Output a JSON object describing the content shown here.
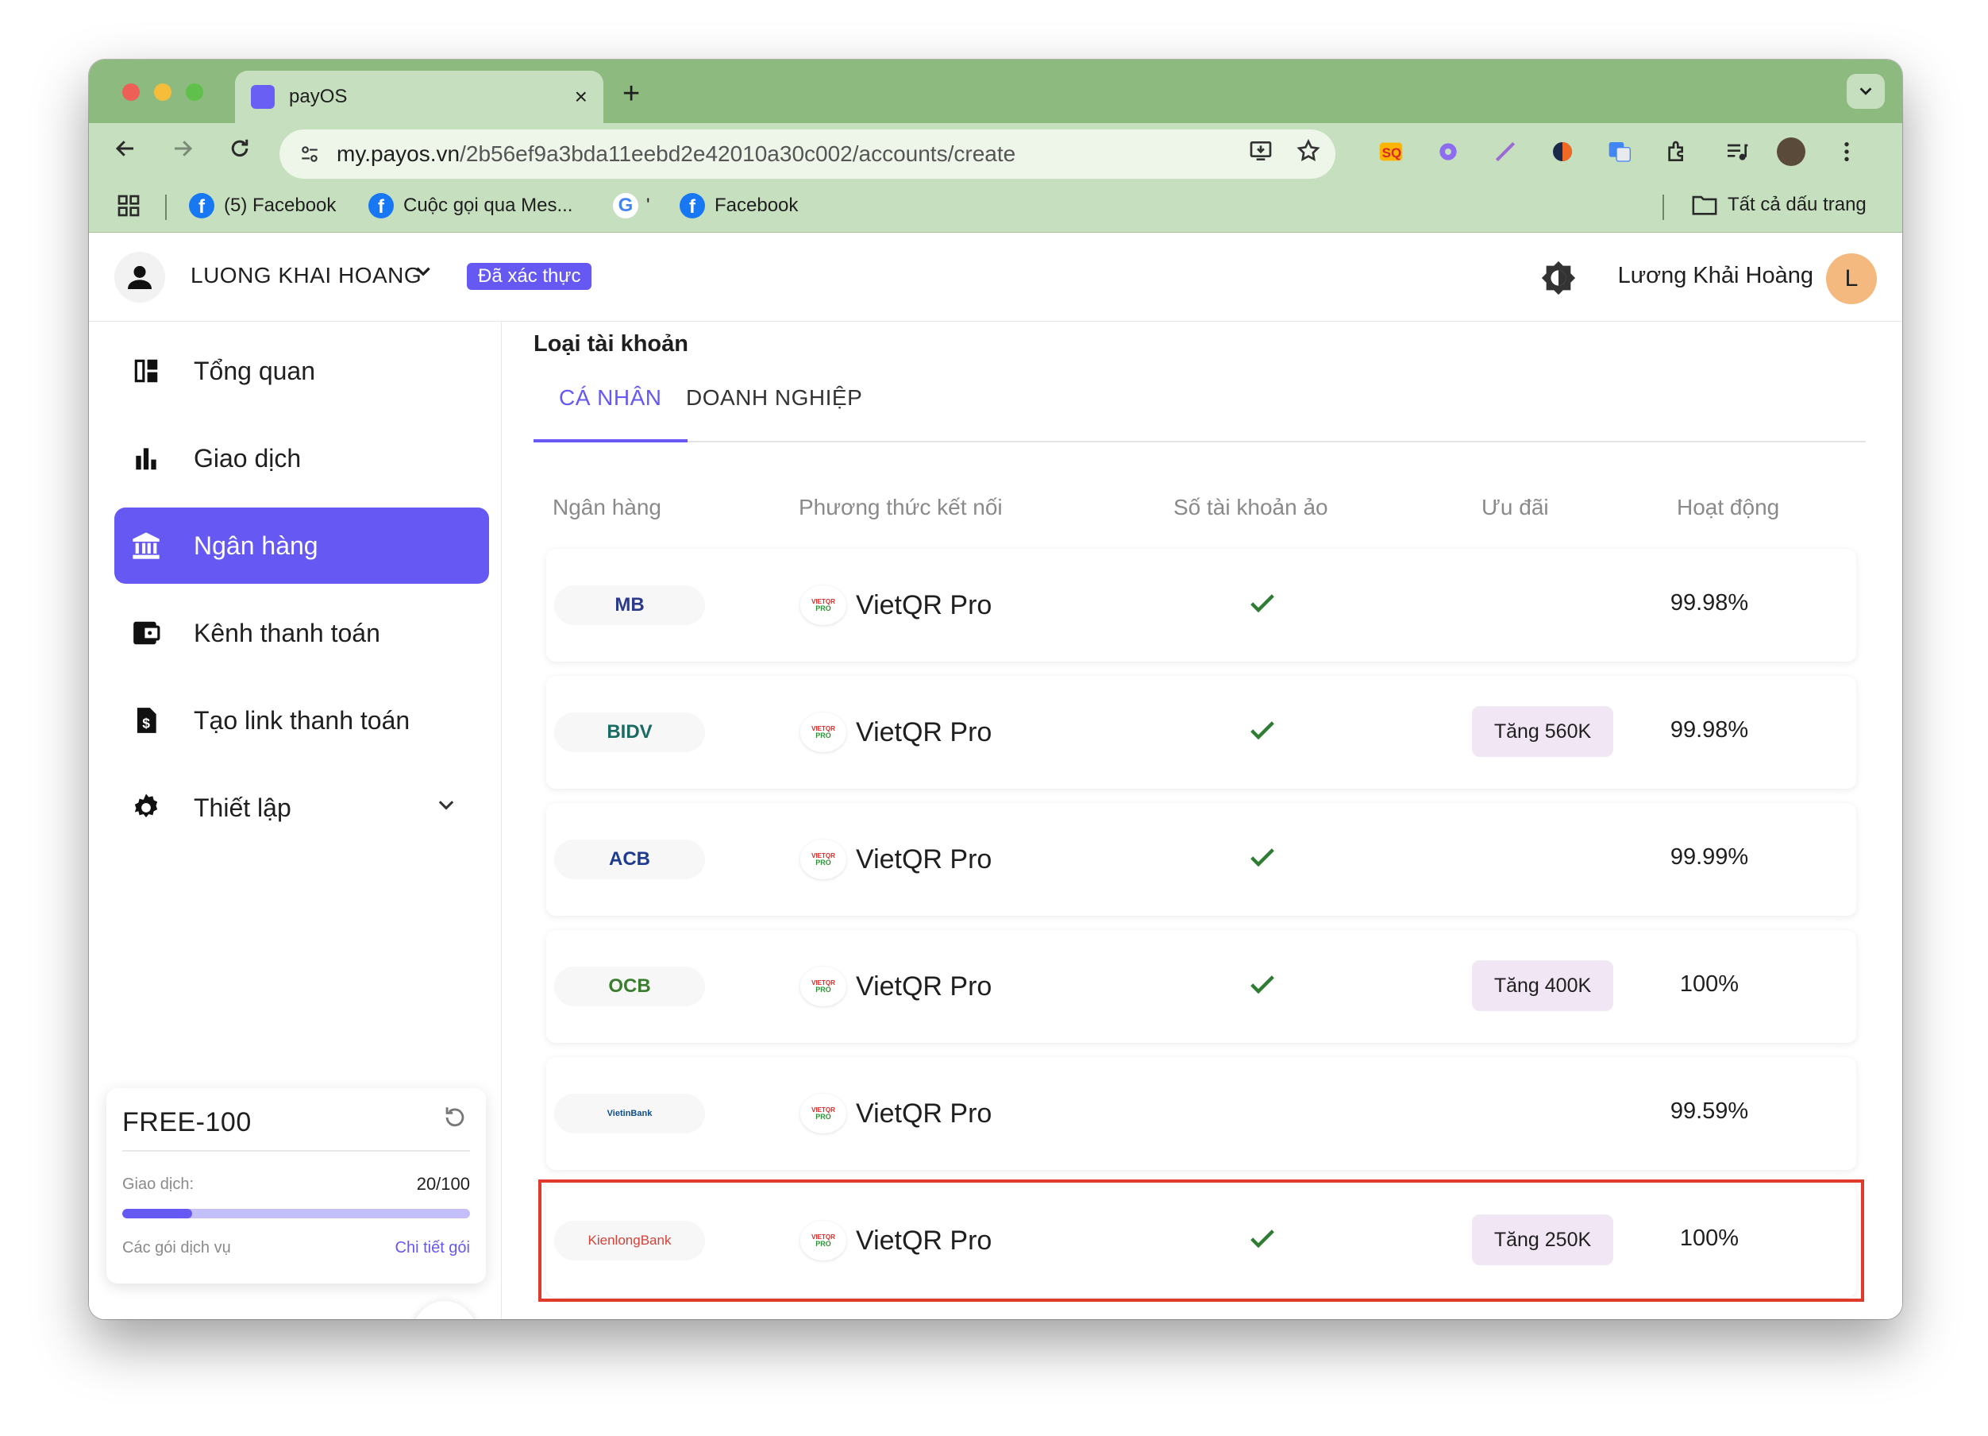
{
  "browser": {
    "tab_title": "payOS",
    "tab_close": "×",
    "new_tab": "+",
    "url_host": "my.payos.vn",
    "url_path": "/2b56ef9a3bda11eebd2e42010a30c002/accounts/create",
    "bookmarks": [
      {
        "label": "(5) Facebook"
      },
      {
        "label": "Cuộc gọi qua Mes..."
      },
      {
        "label": "'"
      },
      {
        "label": "Facebook"
      }
    ],
    "all_bookmarks": "Tất cả dấu trang"
  },
  "header": {
    "org_name": "LUONG KHAI HOANG",
    "verified_badge": "Đã xác thực",
    "user_name": "Lương Khải Hoàng",
    "user_initial": "L"
  },
  "sidebar": {
    "items": [
      {
        "label": "Tổng quan",
        "icon": "dashboard-icon"
      },
      {
        "label": "Giao dịch",
        "icon": "bar-chart-icon"
      },
      {
        "label": "Ngân hàng",
        "icon": "bank-icon",
        "active": true
      },
      {
        "label": "Kênh thanh toán",
        "icon": "wallet-icon"
      },
      {
        "label": "Tạo link thanh toán",
        "icon": "invoice-icon"
      },
      {
        "label": "Thiết lập",
        "icon": "gear-icon"
      }
    ]
  },
  "plan": {
    "name": "FREE-100",
    "transactions_label": "Giao dịch:",
    "transactions_value": "20/100",
    "usage_fraction": 0.2,
    "services_label": "Các gói dịch vụ",
    "detail_link": "Chi tiết gói"
  },
  "main": {
    "section_title": "Loại tài khoản",
    "tabs": [
      {
        "label": "CÁ NHÂN",
        "active": true
      },
      {
        "label": "DOANH NGHIỆP",
        "active": false
      }
    ],
    "columns": [
      "Ngân hàng",
      "Phương thức kết nối",
      "Số tài khoản ảo",
      "Ưu đãi",
      "Hoạt động"
    ],
    "rows": [
      {
        "bank": "MB",
        "method": "VietQR Pro",
        "virtual_account": true,
        "promo": "",
        "uptime": "99.98%"
      },
      {
        "bank": "BIDV",
        "method": "VietQR Pro",
        "virtual_account": true,
        "promo": "Tăng 560K",
        "uptime": "99.98%"
      },
      {
        "bank": "ACB",
        "method": "VietQR Pro",
        "virtual_account": true,
        "promo": "",
        "uptime": "99.99%"
      },
      {
        "bank": "OCB",
        "method": "VietQR Pro",
        "virtual_account": true,
        "promo": "Tăng 400K",
        "uptime": "100%"
      },
      {
        "bank": "VietinBank",
        "method": "VietQR Pro",
        "virtual_account": false,
        "promo": "",
        "uptime": "99.59%"
      },
      {
        "bank": "KienlongBank",
        "method": "VietQR Pro",
        "virtual_account": true,
        "promo": "Tăng 250K",
        "uptime": "100%"
      }
    ],
    "vietqr_badge_top": "VIETQR",
    "vietqr_badge_bottom": "PRO"
  },
  "colors": {
    "accent": "#6658f2",
    "highlight_border": "#e03a2c",
    "chrome_tabstrip": "#8cba7f",
    "chrome_toolbar": "#c6dfbe",
    "check": "#2e7d32",
    "promo_bg": "#f1e6f3"
  }
}
